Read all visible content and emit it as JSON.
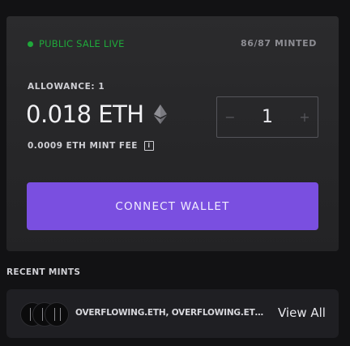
{
  "sale": {
    "status": "PUBLIC SALE LIVE",
    "minted": "86/87 MINTED",
    "status_color": "#1fa83a"
  },
  "price": {
    "allowance": "ALLOWANCE: 1",
    "amount": "0.018 ETH",
    "icon": "ethereum-icon",
    "fee": "0.0009 ETH MINT FEE",
    "fee_info_icon": "info-icon",
    "fee_info_glyph": "i"
  },
  "stepper": {
    "decrement": "−",
    "quantity": "1",
    "increment": "+"
  },
  "actions": {
    "connect_label": "CONNECT WALLET",
    "accent": "#7a4fe0"
  },
  "recent": {
    "label": "RECENT MINTS",
    "names": "OVERFLOWING.ETH, OVERFLOWING.ETH, OV...",
    "view_all": "View All"
  }
}
